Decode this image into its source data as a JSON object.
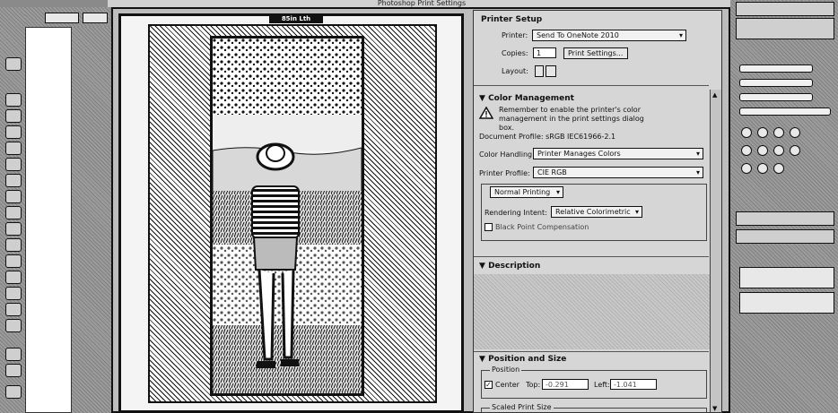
{
  "window": {
    "title": "Photoshop Print Settings"
  },
  "preview": {
    "dimension_label": "85in Lth"
  },
  "printer_setup": {
    "title": "Printer Setup",
    "printer_label": "Printer:",
    "printer_value": "Send To OneNote 2010",
    "copies_label": "Copies:",
    "copies_value": "1",
    "print_settings_button": "Print Settings...",
    "layout_label": "Layout:"
  },
  "color_management": {
    "title": "Color Management",
    "warning_text": "Remember to enable the printer's color management in the print settings dialog box.",
    "document_profile": "Document Profile: sRGB IEC61966-2.1",
    "color_handling_label": "Color Handling:",
    "color_handling_value": "Printer Manages Colors",
    "printer_profile_label": "Printer Profile:",
    "printer_profile_value": "CIE RGB",
    "printing_mode": "Normal Printing",
    "rendering_intent_label": "Rendering Intent:",
    "rendering_intent_value": "Relative Colorimetric",
    "black_point_label": "Black Point Compensation"
  },
  "description": {
    "title": "Description"
  },
  "position_size": {
    "title": "Position and Size",
    "position_group": "Position",
    "center_label": "Center",
    "top_label": "Top:",
    "top_value": "-0.291",
    "left_label": "Left:",
    "left_value": "-1.041",
    "scaled_group": "Scaled Print Size"
  },
  "icons": [
    "warning-icon",
    "layout-portrait-icon",
    "layout-landscape-icon",
    "expand-arrow-icon",
    "collapse-arrow-icon",
    "checkbox-icon"
  ]
}
